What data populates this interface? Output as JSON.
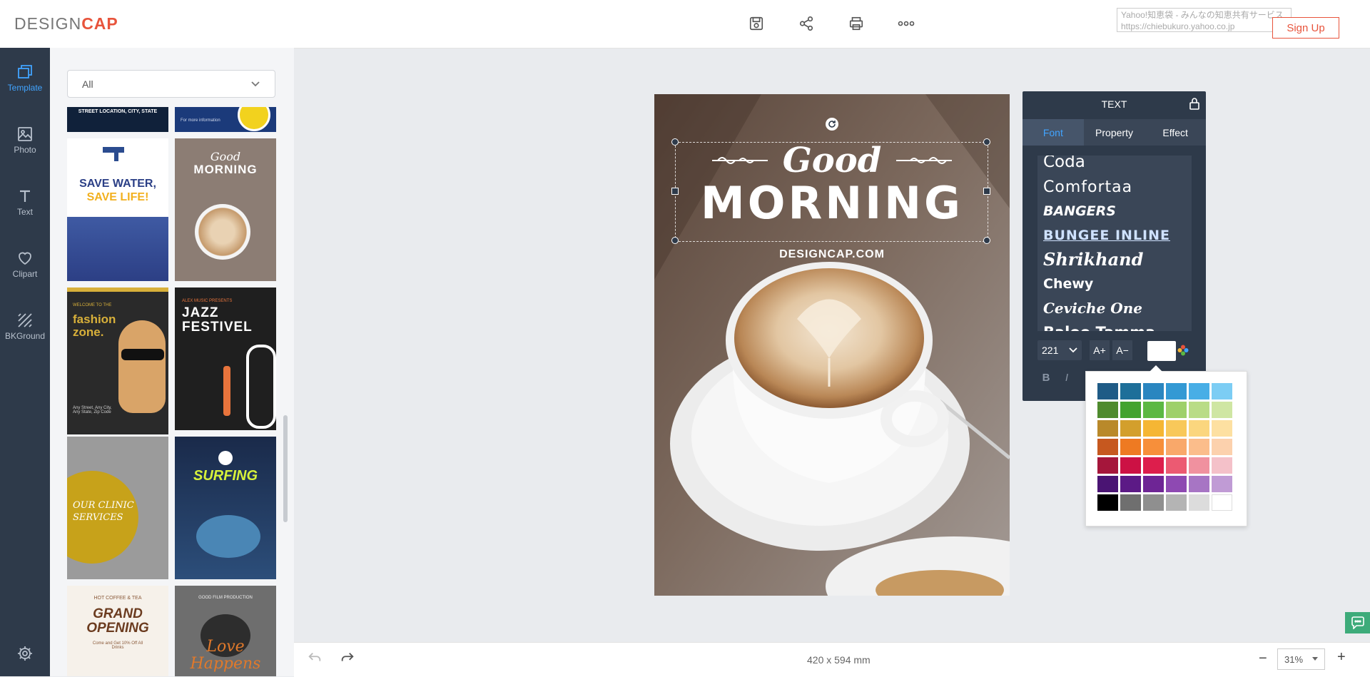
{
  "app": {
    "logo_design": "DESIGN",
    "logo_cap": "CAP"
  },
  "toolbar": {
    "save": "save-icon",
    "share": "share-icon",
    "print": "print-icon",
    "more": "more-icon"
  },
  "browser_popup": {
    "line1": "Yahoo!知恵袋 - みんなの知恵共有サービス",
    "line2": "https://chiebukuro.yahoo.co.jp"
  },
  "signup_label": "Sign Up",
  "leftnav": [
    {
      "label": "Template",
      "icon": "template-icon",
      "active": true
    },
    {
      "label": "Photo",
      "icon": "photo-icon"
    },
    {
      "label": "Text",
      "icon": "text-icon"
    },
    {
      "label": "Clipart",
      "icon": "clipart-icon"
    },
    {
      "label": "BKGround",
      "icon": "background-icon"
    }
  ],
  "template_panel": {
    "filter_value": "All",
    "thumbs": {
      "t1_text": "STREET LOCATION, CITY, STATE",
      "t2_text": "For more information",
      "save_water_1": "SAVE WATER,",
      "save_water_2": "SAVE LIFE!",
      "good": "Good",
      "morning": "MORNING",
      "fashion_welcome": "WELCOME TO THE",
      "fashion_1": "fashion",
      "fashion_2": "zone.",
      "fashion_addr": "Any Street, Any City, Any State, Zip Code",
      "jazz_pre": "ALEX MUSIC PRESENTS",
      "jazz_1": "JAZZ",
      "jazz_2": "FESTIVEL",
      "clinic_1": "OUR CLINIC",
      "clinic_2": "SERVICES",
      "surfing": "SURFING",
      "hot_coffee": "HOT COFFEE & TEA",
      "grand_1": "GRAND",
      "grand_2": "OPENING",
      "grand_sub": "Come and Get 10% Off All Drinks",
      "love_pre": "GOOD FILM PRODUCTION",
      "love_1": "Love",
      "love_2": "Happens"
    }
  },
  "canvas": {
    "good": "Good",
    "morning": "MORNING",
    "site": "DESIGNCAP.COM"
  },
  "bottom": {
    "dimensions": "420 x 594 mm",
    "zoom": "31%",
    "zoom_out": "−",
    "zoom_in": "+"
  },
  "text_panel": {
    "title": "TEXT",
    "tabs": [
      "Font",
      "Property",
      "Effect"
    ],
    "fonts": [
      "Coda",
      "Comfortaa",
      "BANGERS",
      "BUNGEE INLINE",
      "Shrikhand",
      "Chewy",
      "Ceviche One",
      "Baloo Tamma"
    ],
    "font_size": "221",
    "increase": "A+",
    "decrease": "A−",
    "bold": "B",
    "italic": "I"
  },
  "colors": {
    "accent": "#41a4ff",
    "brand": "#e8543c",
    "panel": "#2e3a4a",
    "palette": [
      [
        "#1f5b86",
        "#1e6f99",
        "#2a86c0",
        "#3399d4",
        "#48aee6",
        "#7ccdf4"
      ],
      [
        "#4f8b2e",
        "#43a32f",
        "#5cb843",
        "#9ed06a",
        "#b9dc86",
        "#cfe6a3"
      ],
      [
        "#b9892a",
        "#d39f2c",
        "#f5b634",
        "#f8c85a",
        "#fbd67e",
        "#fde0a1"
      ],
      [
        "#c6581f",
        "#ee7a22",
        "#f78f3a",
        "#f9a86a",
        "#fbbd8b",
        "#fcd1ad"
      ],
      [
        "#a5163b",
        "#cc1144",
        "#dd1e4c",
        "#ec5a72",
        "#f0919f",
        "#f4c1c9"
      ],
      [
        "#4a1473",
        "#5c1a86",
        "#6e2595",
        "#8e49b2",
        "#a775c4",
        "#c09bd5"
      ],
      [
        "#000000",
        "#6f6f6f",
        "#8f8f8f",
        "#b4b4b4",
        "#dcdcdc",
        "#ffffff"
      ]
    ]
  }
}
